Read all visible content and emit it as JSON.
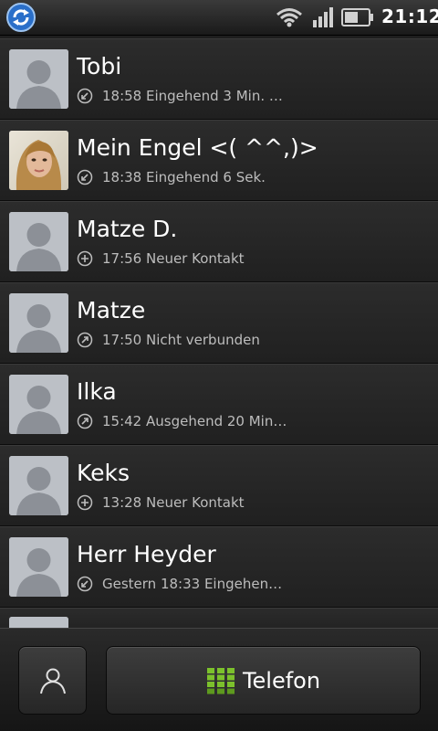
{
  "status_bar": {
    "time": "21:12",
    "icons": [
      "sync-icon",
      "wifi-icon",
      "signal-icon",
      "battery-icon"
    ]
  },
  "calls": [
    {
      "name": "Tobi",
      "detail": "18:58 Eingehend 3 Min. …",
      "type": "incoming",
      "avatar": "default"
    },
    {
      "name": "Mein Engel <( ^^,)>",
      "detail": "18:38 Eingehend 6 Sek.",
      "type": "incoming",
      "avatar": "photo"
    },
    {
      "name": "Matze D.",
      "detail": "17:56 Neuer Kontakt",
      "type": "new-contact",
      "avatar": "default"
    },
    {
      "name": "Matze",
      "detail": "17:50 Nicht verbunden",
      "type": "outgoing",
      "avatar": "default"
    },
    {
      "name": "Ilka",
      "detail": "15:42 Ausgehend 20 Min…",
      "type": "outgoing",
      "avatar": "default"
    },
    {
      "name": "Keks",
      "detail": "13:28 Neuer Kontakt",
      "type": "new-contact",
      "avatar": "default"
    },
    {
      "name": "Herr Heyder",
      "detail": "Gestern 18:33 Eingehen…",
      "type": "incoming",
      "avatar": "default"
    }
  ],
  "bottom_bar": {
    "phone_label": "Telefon"
  },
  "colors": {
    "background": "#1e1e1e",
    "text_primary": "#ffffff",
    "text_secondary": "#bdbdbd",
    "keypad_green": "#7cc12c"
  }
}
